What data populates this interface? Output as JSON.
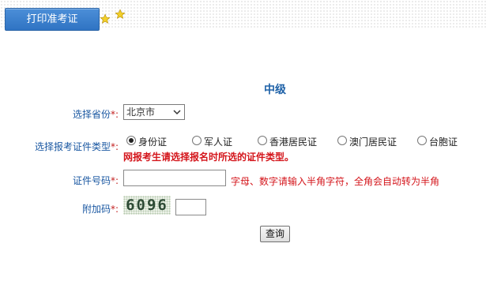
{
  "header": {
    "tab_label": "打印准考证",
    "icons": [
      "star-icon",
      "star-icon"
    ]
  },
  "form": {
    "title": "中级",
    "province": {
      "label": "选择省份",
      "required_mark": "*:",
      "selected": "北京市"
    },
    "id_type": {
      "label": "选择报考证件类型",
      "required_mark": "*:",
      "options": [
        "身份证",
        "军人证",
        "香港居民证",
        "澳门居民证",
        "台胞证"
      ],
      "selected_index": 0,
      "warning": "网报考生请选择报名时所选的证件类型。"
    },
    "id_number": {
      "label": "证件号码",
      "required_mark": "*:",
      "value": "",
      "hint": "字母、数字请输入半角字符，全角会自动转为半角"
    },
    "captcha": {
      "label": "附加码",
      "required_mark": "*:",
      "image_text": "6096",
      "value": ""
    },
    "submit_label": "查询"
  },
  "colors": {
    "tab_bg": "#3a80cf",
    "label_blue": "#1b58a2",
    "title_blue": "#1f62a8",
    "warning_red": "#d4151b"
  }
}
